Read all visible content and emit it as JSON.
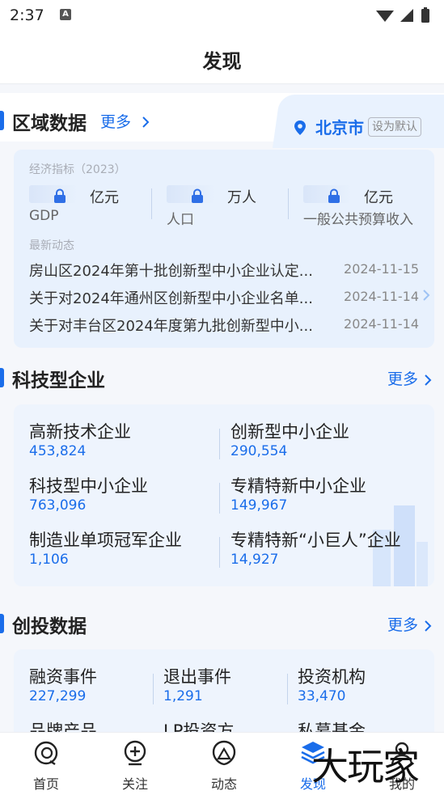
{
  "status": {
    "time": "2:37",
    "notif_glyph": "A"
  },
  "header": {
    "title": "发现"
  },
  "region": {
    "title": "区域数据",
    "more": "更多",
    "city": "北京市",
    "set_default": "设为默认",
    "econ_label": "经济指标（2023）",
    "indicators": [
      {
        "unit": "亿元",
        "name": "GDP"
      },
      {
        "unit": "万人",
        "name": "人口"
      },
      {
        "unit": "亿元",
        "name": "一般公共预算收入"
      }
    ],
    "news_label": "最新动态",
    "news": [
      {
        "title": "房山区2024年第十批创新型中小企业认定...",
        "date": "2024-11-15"
      },
      {
        "title": "关于对2024年通州区创新型中小企业名单...",
        "date": "2024-11-14"
      },
      {
        "title": "关于对丰台区2024年度第九批创新型中小...",
        "date": "2024-11-14"
      }
    ]
  },
  "tech": {
    "title": "科技型企业",
    "more": "更多",
    "items": [
      {
        "name": "高新技术企业",
        "value": "453,824"
      },
      {
        "name": "创新型中小企业",
        "value": "290,554"
      },
      {
        "name": "科技型中小企业",
        "value": "763,096"
      },
      {
        "name": "专精特新中小企业",
        "value": "149,967"
      },
      {
        "name": "制造业单项冠军企业",
        "value": "1,106"
      },
      {
        "name": "专精特新“小巨人”企业",
        "value": "14,927"
      }
    ]
  },
  "venture": {
    "title": "创投数据",
    "more": "更多",
    "items": [
      {
        "name": "融资事件",
        "value": "227,299"
      },
      {
        "name": "退出事件",
        "value": "1,291"
      },
      {
        "name": "投资机构",
        "value": "33,470"
      },
      {
        "name": "品牌产品",
        "value": ""
      },
      {
        "name": "LP投资方",
        "value": ""
      },
      {
        "name": "私募基金",
        "value": ""
      }
    ]
  },
  "nav": [
    {
      "label": "首页",
      "icon": "home-icon"
    },
    {
      "label": "关注",
      "icon": "follow-icon"
    },
    {
      "label": "动态",
      "icon": "activity-icon"
    },
    {
      "label": "发现",
      "icon": "discover-icon"
    },
    {
      "label": "我的",
      "icon": "profile-icon"
    }
  ],
  "watermark": "大玩家",
  "colors": {
    "accent": "#1a6dea",
    "text": "#222222",
    "muted": "#888888"
  }
}
